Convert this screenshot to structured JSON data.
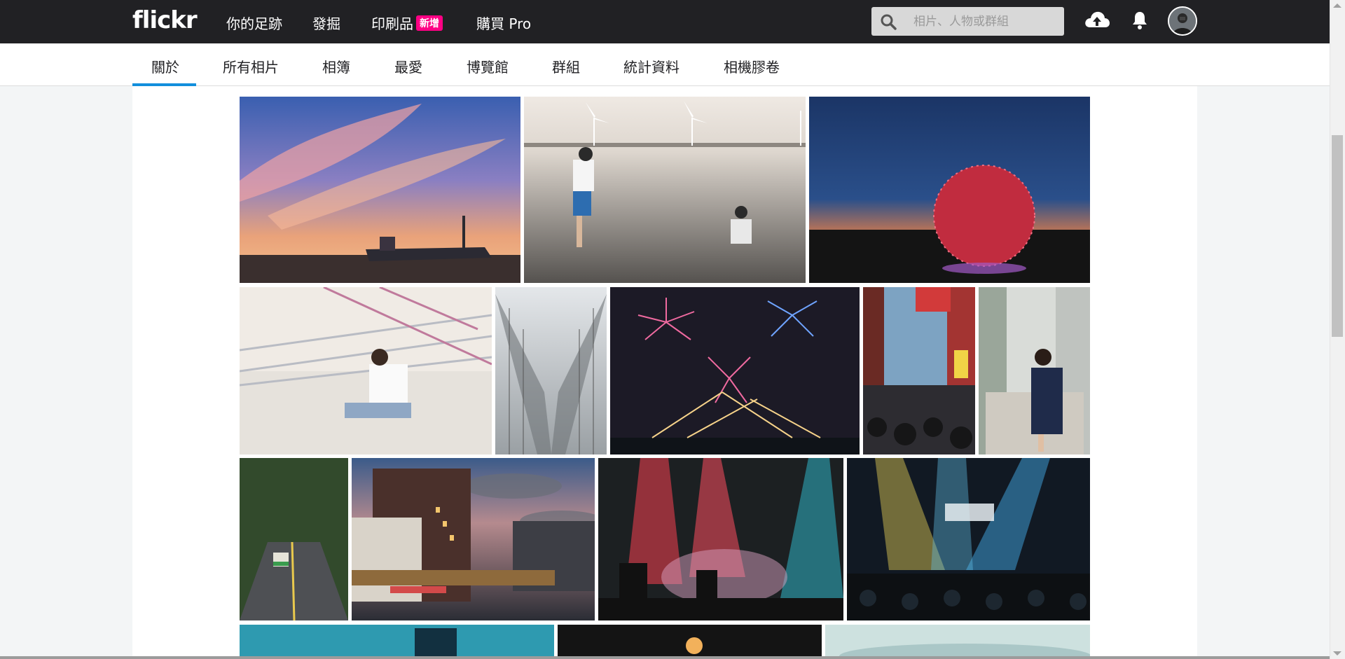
{
  "header": {
    "logo": "flickr",
    "nav": [
      {
        "label": "你的足跡"
      },
      {
        "label": "發掘"
      },
      {
        "label": "印刷品",
        "badge": "新增"
      },
      {
        "label": "購買 Pro"
      }
    ],
    "search_placeholder": "相片、人物或群組",
    "icons": [
      "search-icon",
      "upload-cloud-icon",
      "bell-icon",
      "avatar"
    ]
  },
  "subnav": {
    "tabs": [
      {
        "label": "關於",
        "active": true
      },
      {
        "label": "所有相片"
      },
      {
        "label": "相簿"
      },
      {
        "label": "最愛"
      },
      {
        "label": "博覽館"
      },
      {
        "label": "群組"
      },
      {
        "label": "統計資料"
      },
      {
        "label": "相機膠卷"
      }
    ],
    "active_color": "#128fdc"
  },
  "photos": [
    {
      "subject": "sunset-shipwreck"
    },
    {
      "subject": "wind-turbines-tidal-flat"
    },
    {
      "subject": "red-sphere-dusk"
    },
    {
      "subject": "girl-on-bridge"
    },
    {
      "subject": "misty-suspension-bridge"
    },
    {
      "subject": "fireworks"
    },
    {
      "subject": "night-market-street"
    },
    {
      "subject": "woman-street-portrait"
    },
    {
      "subject": "tree-tunnel-road"
    },
    {
      "subject": "building-sunset"
    },
    {
      "subject": "red-stage-concert"
    },
    {
      "subject": "blue-stage-concert"
    },
    {
      "subject": "blue-concert-partial"
    },
    {
      "subject": "sparkler-partial"
    },
    {
      "subject": "sky-partial"
    }
  ],
  "colors": {
    "topbar": "#212124",
    "badge": "#ff0084",
    "background": "#f3f5f6"
  }
}
